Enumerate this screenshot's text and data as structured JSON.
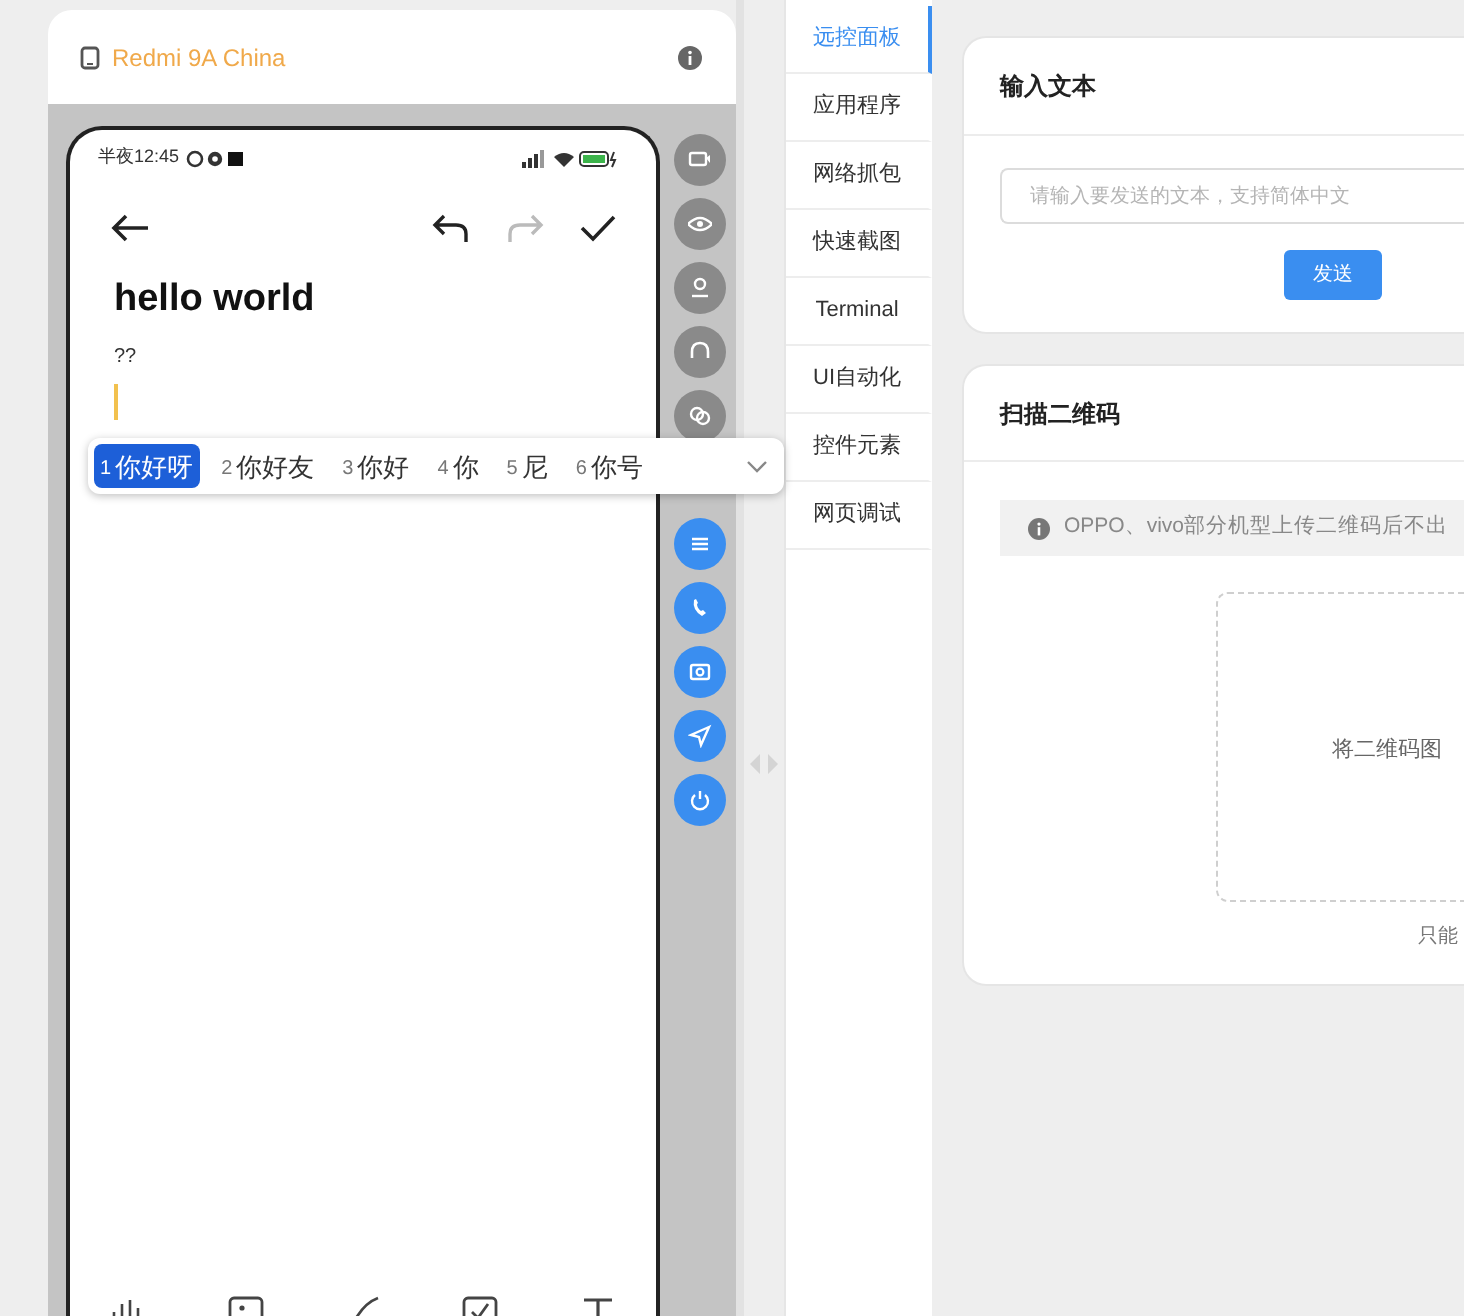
{
  "device": {
    "name": "Redmi 9A China"
  },
  "phone": {
    "status_time": "半夜12:45",
    "title": "hello world",
    "body": "??"
  },
  "candidates": [
    {
      "index": "1",
      "text": "你好呀",
      "selected": true
    },
    {
      "index": "2",
      "text": "你好友",
      "selected": false
    },
    {
      "index": "3",
      "text": "你好",
      "selected": false
    },
    {
      "index": "4",
      "text": "你",
      "selected": false
    },
    {
      "index": "5",
      "text": "尼",
      "selected": false
    },
    {
      "index": "6",
      "text": "你号",
      "selected": false
    }
  ],
  "side_buttons": [
    {
      "active": false
    },
    {
      "active": false
    },
    {
      "active": false
    },
    {
      "active": false
    },
    {
      "active": false
    },
    {
      "active": true
    },
    {
      "active": true
    },
    {
      "active": true
    },
    {
      "active": true
    },
    {
      "active": true
    }
  ],
  "nav": [
    {
      "label": "远控面板",
      "selected": true
    },
    {
      "label": "应用程序",
      "selected": false
    },
    {
      "label": "网络抓包",
      "selected": false
    },
    {
      "label": "快速截图",
      "selected": false
    },
    {
      "label": "Terminal",
      "selected": false
    },
    {
      "label": "UI自动化",
      "selected": false
    },
    {
      "label": "控件元素",
      "selected": false
    },
    {
      "label": "网页调试",
      "selected": false
    }
  ],
  "input_card": {
    "title": "输入文本",
    "placeholder": "请输入要发送的文本，支持简体中文",
    "button": "发送"
  },
  "qr_card": {
    "title": "扫描二维码",
    "notice": "OPPO、vivo部分机型上传二维码后不出",
    "drop_text": "将二维码图",
    "hint": "只能"
  }
}
